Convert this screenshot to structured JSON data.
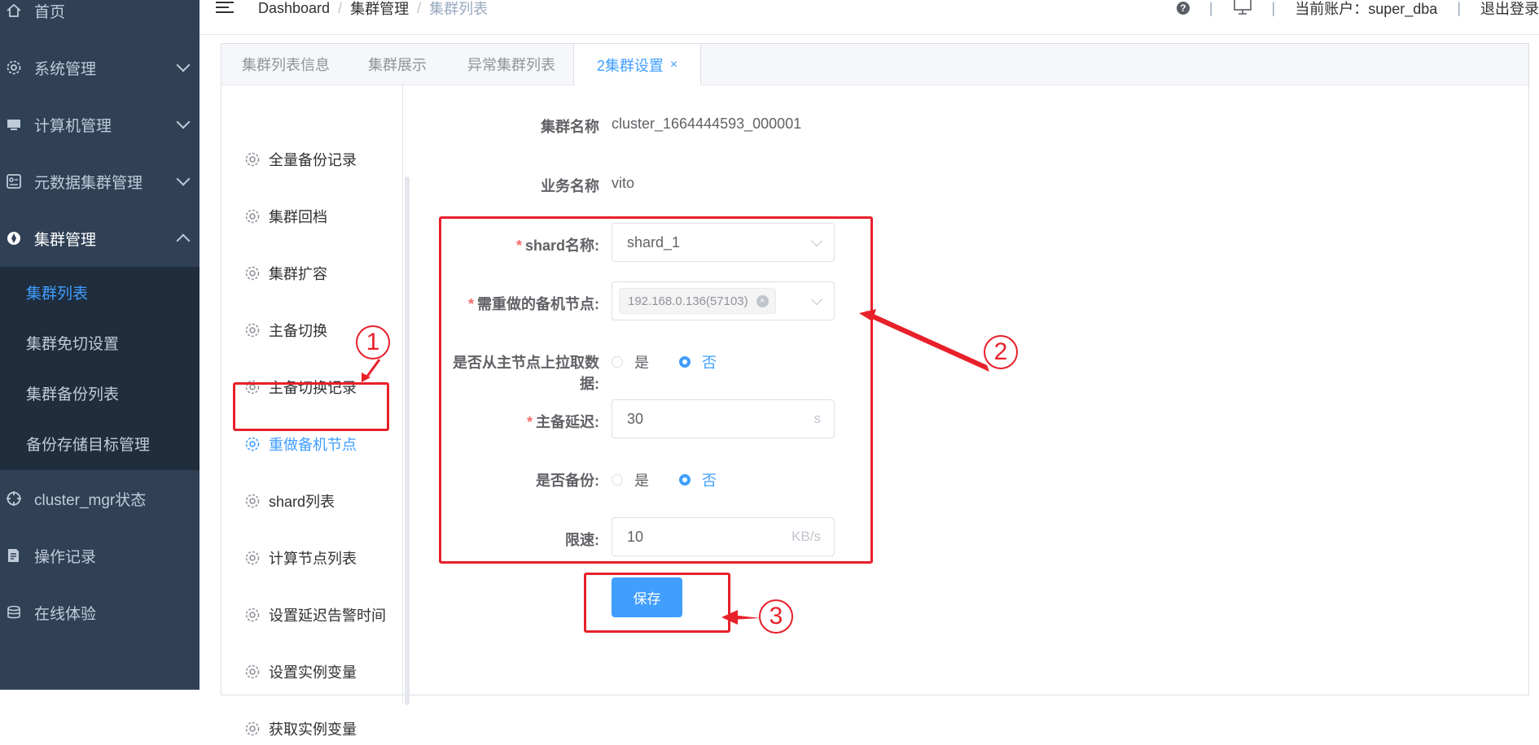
{
  "sidebar": {
    "items": [
      {
        "label": "首页",
        "icon": "home-icon"
      },
      {
        "label": "系统管理",
        "icon": "gear-icon"
      },
      {
        "label": "计算机管理",
        "icon": "monitor-icon"
      },
      {
        "label": "元数据集群管理",
        "icon": "dashboard-icon"
      },
      {
        "label": "集群管理",
        "icon": "cluster-icon"
      },
      {
        "label": "cluster_mgr状态",
        "icon": "target-icon"
      },
      {
        "label": "操作记录",
        "icon": "record-icon"
      },
      {
        "label": "在线体验",
        "icon": "database-icon"
      }
    ],
    "submenu": [
      "集群列表",
      "集群免切设置",
      "集群备份列表",
      "备份存储目标管理"
    ]
  },
  "navbar": {
    "breadcrumb": [
      "Dashboard",
      "集群管理",
      "集群列表"
    ],
    "account": "当前账户：super_dba",
    "logout": "退出登录"
  },
  "tabs": [
    "集群列表信息",
    "集群展示",
    "异常集群列表",
    "2集群设置"
  ],
  "tab_close": "×",
  "side_menu": [
    "全量备份记录",
    "集群回档",
    "集群扩容",
    "主备切换",
    "主备切换记录",
    "重做备机节点",
    "shard列表",
    "计算节点列表",
    "设置延迟告警时间",
    "设置实例变量",
    "获取实例变量"
  ],
  "form": {
    "cluster_name_label": "集群名称",
    "cluster_name": "cluster_1664444593_000001",
    "business_name_label": "业务名称",
    "business_name": "vito",
    "required_mark": "*",
    "shard_label": "shard名称:",
    "shard_value": "shard_1",
    "node_label": "需重做的备机节点:",
    "node_tag": "192.168.0.136(57103)",
    "tag_close": "×",
    "pull_label": "是否从主节点上拉取数据:",
    "yes": "是",
    "no": "否",
    "delay_label": "主备延迟:",
    "delay_value": "30",
    "delay_unit": "s",
    "backup_label": "是否备份:",
    "limit_label": "限速:",
    "limit_value": "10",
    "limit_unit": "KB/s",
    "save": "保存"
  },
  "annotations": {
    "one": "1",
    "two": "2",
    "three": "3"
  },
  "colors": {
    "sidebar_bg": "#304156",
    "submenu_bg": "#1f2d3d",
    "accent": "#409eff",
    "annotation_red": "#e8202a"
  }
}
